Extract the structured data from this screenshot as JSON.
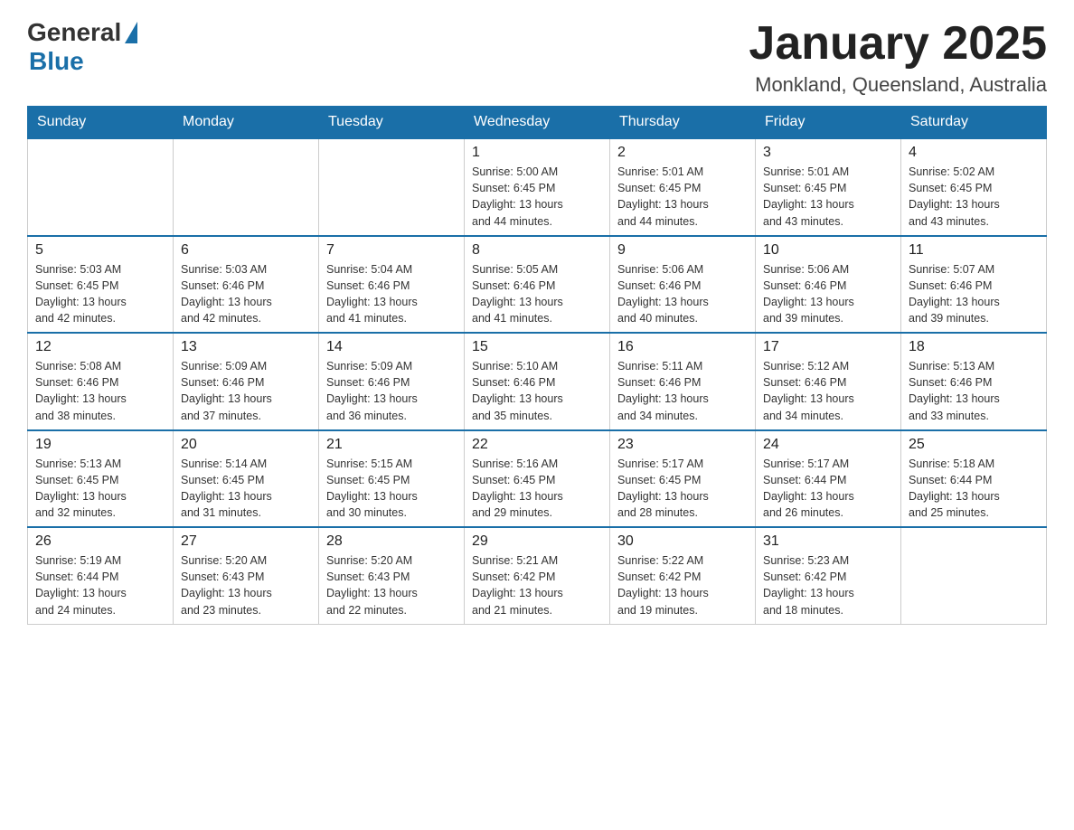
{
  "header": {
    "logo_general": "General",
    "logo_blue": "Blue",
    "month_title": "January 2025",
    "location": "Monkland, Queensland, Australia"
  },
  "weekdays": [
    "Sunday",
    "Monday",
    "Tuesday",
    "Wednesday",
    "Thursday",
    "Friday",
    "Saturday"
  ],
  "weeks": [
    [
      {
        "day": "",
        "info": ""
      },
      {
        "day": "",
        "info": ""
      },
      {
        "day": "",
        "info": ""
      },
      {
        "day": "1",
        "info": "Sunrise: 5:00 AM\nSunset: 6:45 PM\nDaylight: 13 hours\nand 44 minutes."
      },
      {
        "day": "2",
        "info": "Sunrise: 5:01 AM\nSunset: 6:45 PM\nDaylight: 13 hours\nand 44 minutes."
      },
      {
        "day": "3",
        "info": "Sunrise: 5:01 AM\nSunset: 6:45 PM\nDaylight: 13 hours\nand 43 minutes."
      },
      {
        "day": "4",
        "info": "Sunrise: 5:02 AM\nSunset: 6:45 PM\nDaylight: 13 hours\nand 43 minutes."
      }
    ],
    [
      {
        "day": "5",
        "info": "Sunrise: 5:03 AM\nSunset: 6:45 PM\nDaylight: 13 hours\nand 42 minutes."
      },
      {
        "day": "6",
        "info": "Sunrise: 5:03 AM\nSunset: 6:46 PM\nDaylight: 13 hours\nand 42 minutes."
      },
      {
        "day": "7",
        "info": "Sunrise: 5:04 AM\nSunset: 6:46 PM\nDaylight: 13 hours\nand 41 minutes."
      },
      {
        "day": "8",
        "info": "Sunrise: 5:05 AM\nSunset: 6:46 PM\nDaylight: 13 hours\nand 41 minutes."
      },
      {
        "day": "9",
        "info": "Sunrise: 5:06 AM\nSunset: 6:46 PM\nDaylight: 13 hours\nand 40 minutes."
      },
      {
        "day": "10",
        "info": "Sunrise: 5:06 AM\nSunset: 6:46 PM\nDaylight: 13 hours\nand 39 minutes."
      },
      {
        "day": "11",
        "info": "Sunrise: 5:07 AM\nSunset: 6:46 PM\nDaylight: 13 hours\nand 39 minutes."
      }
    ],
    [
      {
        "day": "12",
        "info": "Sunrise: 5:08 AM\nSunset: 6:46 PM\nDaylight: 13 hours\nand 38 minutes."
      },
      {
        "day": "13",
        "info": "Sunrise: 5:09 AM\nSunset: 6:46 PM\nDaylight: 13 hours\nand 37 minutes."
      },
      {
        "day": "14",
        "info": "Sunrise: 5:09 AM\nSunset: 6:46 PM\nDaylight: 13 hours\nand 36 minutes."
      },
      {
        "day": "15",
        "info": "Sunrise: 5:10 AM\nSunset: 6:46 PM\nDaylight: 13 hours\nand 35 minutes."
      },
      {
        "day": "16",
        "info": "Sunrise: 5:11 AM\nSunset: 6:46 PM\nDaylight: 13 hours\nand 34 minutes."
      },
      {
        "day": "17",
        "info": "Sunrise: 5:12 AM\nSunset: 6:46 PM\nDaylight: 13 hours\nand 34 minutes."
      },
      {
        "day": "18",
        "info": "Sunrise: 5:13 AM\nSunset: 6:46 PM\nDaylight: 13 hours\nand 33 minutes."
      }
    ],
    [
      {
        "day": "19",
        "info": "Sunrise: 5:13 AM\nSunset: 6:45 PM\nDaylight: 13 hours\nand 32 minutes."
      },
      {
        "day": "20",
        "info": "Sunrise: 5:14 AM\nSunset: 6:45 PM\nDaylight: 13 hours\nand 31 minutes."
      },
      {
        "day": "21",
        "info": "Sunrise: 5:15 AM\nSunset: 6:45 PM\nDaylight: 13 hours\nand 30 minutes."
      },
      {
        "day": "22",
        "info": "Sunrise: 5:16 AM\nSunset: 6:45 PM\nDaylight: 13 hours\nand 29 minutes."
      },
      {
        "day": "23",
        "info": "Sunrise: 5:17 AM\nSunset: 6:45 PM\nDaylight: 13 hours\nand 28 minutes."
      },
      {
        "day": "24",
        "info": "Sunrise: 5:17 AM\nSunset: 6:44 PM\nDaylight: 13 hours\nand 26 minutes."
      },
      {
        "day": "25",
        "info": "Sunrise: 5:18 AM\nSunset: 6:44 PM\nDaylight: 13 hours\nand 25 minutes."
      }
    ],
    [
      {
        "day": "26",
        "info": "Sunrise: 5:19 AM\nSunset: 6:44 PM\nDaylight: 13 hours\nand 24 minutes."
      },
      {
        "day": "27",
        "info": "Sunrise: 5:20 AM\nSunset: 6:43 PM\nDaylight: 13 hours\nand 23 minutes."
      },
      {
        "day": "28",
        "info": "Sunrise: 5:20 AM\nSunset: 6:43 PM\nDaylight: 13 hours\nand 22 minutes."
      },
      {
        "day": "29",
        "info": "Sunrise: 5:21 AM\nSunset: 6:42 PM\nDaylight: 13 hours\nand 21 minutes."
      },
      {
        "day": "30",
        "info": "Sunrise: 5:22 AM\nSunset: 6:42 PM\nDaylight: 13 hours\nand 19 minutes."
      },
      {
        "day": "31",
        "info": "Sunrise: 5:23 AM\nSunset: 6:42 PM\nDaylight: 13 hours\nand 18 minutes."
      },
      {
        "day": "",
        "info": ""
      }
    ]
  ]
}
